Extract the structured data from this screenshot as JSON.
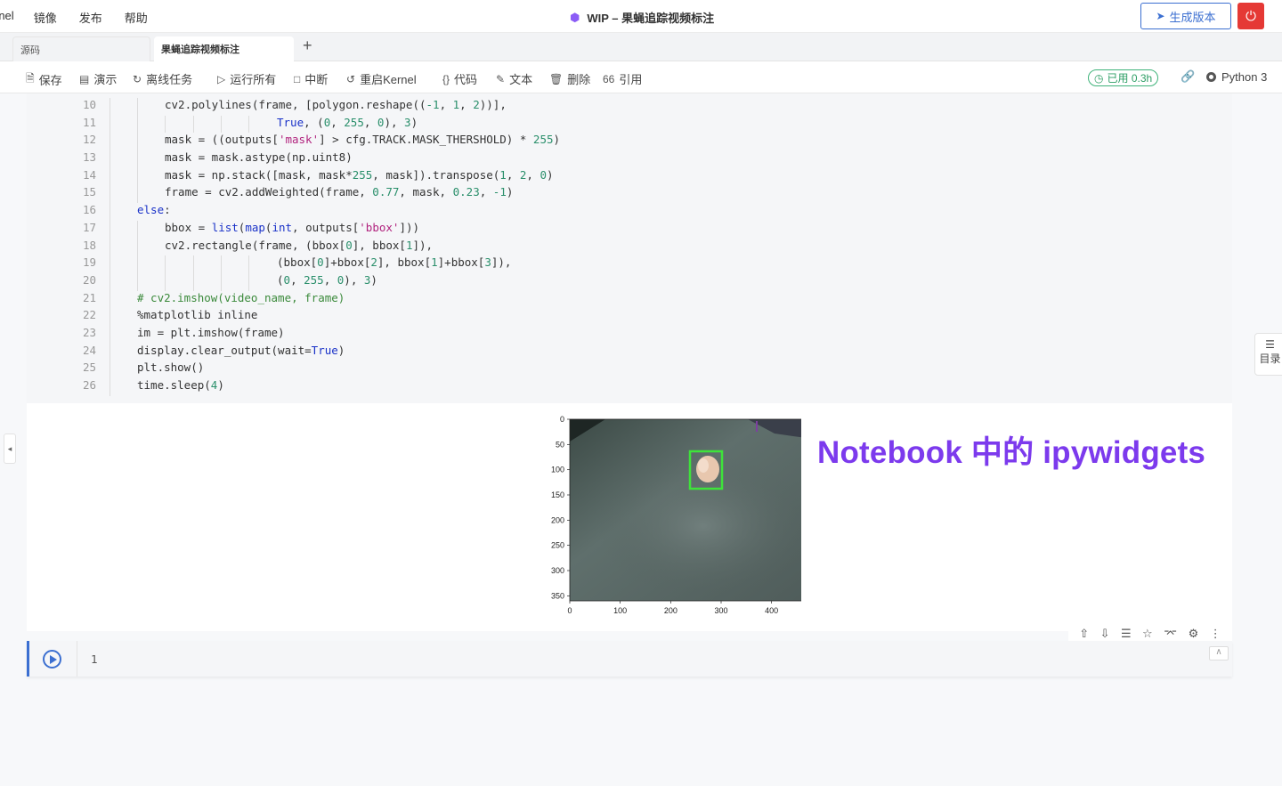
{
  "menubar": {
    "items": [
      "rnel",
      "镜像",
      "发布",
      "帮助"
    ],
    "title": "WIP – 果蝇追踪视频标注",
    "generate_label": "生成版本"
  },
  "tabs": [
    {
      "label": "源码",
      "active": false
    },
    {
      "label": "果蝇追踪视频标注",
      "active": true
    }
  ],
  "toolbar": {
    "save": "保存",
    "present": "演示",
    "offline": "离线任务",
    "run_all": "运行所有",
    "interrupt": "中断",
    "restart": "重启Kernel",
    "code": "代码",
    "text": "文本",
    "delete": "删除",
    "cite": "引用",
    "used": "已用 0.3h",
    "kernel": "Python 3"
  },
  "toc_label": "目录",
  "code_lines": [
    {
      "n": "10",
      "indent": 2,
      "html": "cv2.polylines(frame, [polygon.reshape((-1, 1, 2))],"
    },
    {
      "n": "11",
      "indent": 6,
      "html": "True, (0, 255, 0), 3)"
    },
    {
      "n": "12",
      "indent": 2,
      "html": "mask = ((outputs['mask'] > cfg.TRACK.MASK_THERSHOLD) * 255)"
    },
    {
      "n": "13",
      "indent": 2,
      "html": "mask = mask.astype(np.uint8)"
    },
    {
      "n": "14",
      "indent": 2,
      "html": "mask = np.stack([mask, mask*255, mask]).transpose(1, 2, 0)"
    },
    {
      "n": "15",
      "indent": 2,
      "html": "frame = cv2.addWeighted(frame, 0.77, mask, 0.23, -1)"
    },
    {
      "n": "16",
      "indent": 1,
      "html": "else:"
    },
    {
      "n": "17",
      "indent": 2,
      "html": "bbox = list(map(int, outputs['bbox']))"
    },
    {
      "n": "18",
      "indent": 2,
      "html": "cv2.rectangle(frame, (bbox[0], bbox[1]),"
    },
    {
      "n": "19",
      "indent": 6,
      "html": "(bbox[0]+bbox[2], bbox[1]+bbox[3]),"
    },
    {
      "n": "20",
      "indent": 6,
      "html": "(0, 255, 0), 3)"
    },
    {
      "n": "21",
      "indent": 1,
      "html": "# cv2.imshow(video_name, frame)"
    },
    {
      "n": "22",
      "indent": 1,
      "html": "%matplotlib inline"
    },
    {
      "n": "23",
      "indent": 1,
      "html": "im = plt.imshow(frame)"
    },
    {
      "n": "24",
      "indent": 1,
      "html": "display.clear_output(wait=True)"
    },
    {
      "n": "25",
      "indent": 1,
      "html": "plt.show()"
    },
    {
      "n": "26",
      "indent": 1,
      "html": "time.sleep(4)"
    }
  ],
  "plot": {
    "y_ticks": [
      "0",
      "50",
      "100",
      "150",
      "200",
      "250",
      "300",
      "350"
    ],
    "x_ticks": [
      "0",
      "100",
      "200",
      "300",
      "400"
    ]
  },
  "annotation": "Notebook 中的 ipywidgets",
  "empty_cell_line": "1"
}
